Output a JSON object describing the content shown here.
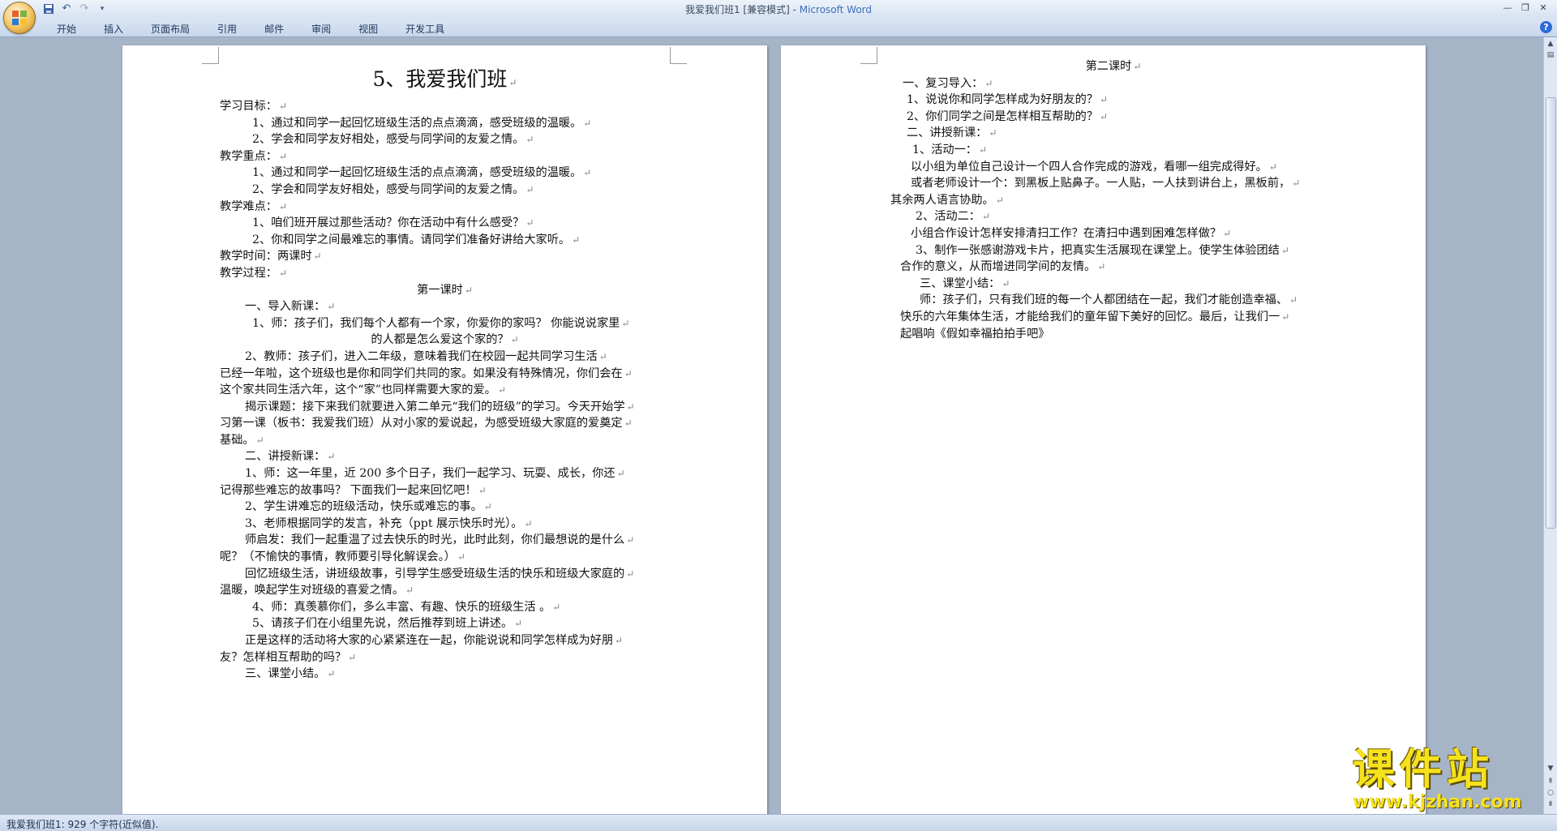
{
  "window": {
    "title_doc": "我爱我们班1 [兼容模式] - ",
    "title_app": "Microsoft Word"
  },
  "quick_access": [
    "save-icon",
    "undo-icon",
    "redo-icon",
    "customize-icon"
  ],
  "ribbon": {
    "tabs": [
      "开始",
      "插入",
      "页面布局",
      "引用",
      "邮件",
      "审阅",
      "视图",
      "开发工具"
    ]
  },
  "page1": {
    "title": "5、我爱我们班",
    "lines": [
      {
        "t": "学习目标：",
        "s": ""
      },
      {
        "t": "1、通过和同学一起回忆班级生活的点点滴滴，感受班级的温暖。",
        "s": "ind2"
      },
      {
        "t": "2、学会和同学友好相处，感受与同学间的友爱之情。",
        "s": "ind2"
      },
      {
        "t": "教学重点：",
        "s": ""
      },
      {
        "t": "1、通过和同学一起回忆班级生活的点点滴滴，感受班级的温暖。",
        "s": "ind2"
      },
      {
        "t": "2、学会和同学友好相处，感受与同学间的友爱之情。",
        "s": "ind2"
      },
      {
        "t": "教学难点：",
        "s": ""
      },
      {
        "t": "1、咱们班开展过那些活动？你在活动中有什么感受？",
        "s": "ind2"
      },
      {
        "t": "2、你和同学之间最难忘的事情。请同学们准备好讲给大家听。",
        "s": "ind2"
      },
      {
        "t": "教学时间：两课时",
        "s": ""
      },
      {
        "t": "教学过程：",
        "s": ""
      },
      {
        "t": "第一课时",
        "s": "center"
      },
      {
        "t": "一、导入新课：",
        "s": "ind1"
      },
      {
        "t": "1、师：孩子们，我们每个人都有一个家，你爱你的家吗？  你能说说家里",
        "s": "ind2"
      },
      {
        "t": "的人都是怎么爱这个家的？",
        "s": "center"
      },
      {
        "t": "2、教师：孩子们，进入二年级，意味着我们在校园一起共同学习生活",
        "s": "ind1"
      },
      {
        "t": "已经一年啦，这个班级也是你和同学们共同的家。如果没有特殊情况，你们会在",
        "s": ""
      },
      {
        "t": "这个家共同生活六年，这个“家”也同样需要大家的爱。",
        "s": ""
      },
      {
        "t": "揭示课题：接下来我们就要进入第二单元“我们的班级”的学习。今天开始学",
        "s": "ind1"
      },
      {
        "t": "习第一课（板书：我爱我们班）从对小家的爱说起，为感受班级大家庭的爱奠定",
        "s": ""
      },
      {
        "t": "基础。",
        "s": ""
      },
      {
        "t": "二、讲授新课：",
        "s": "ind1"
      },
      {
        "t": "1、师：这一年里，近 200 多个日子，我们一起学习、玩耍、成长，你还",
        "s": "ind1"
      },
      {
        "t": "记得那些难忘的故事吗？  下面我们一起来回忆吧！",
        "s": ""
      },
      {
        "t": "2、学生讲难忘的班级活动，快乐或难忘的事。",
        "s": "ind1"
      },
      {
        "t": "3、老师根据同学的发言，补充（ppt 展示快乐时光）。",
        "s": "ind1"
      },
      {
        "t": "师启发：我们一起重温了过去快乐的时光，此时此刻，你们最想说的是什么",
        "s": "ind1"
      },
      {
        "t": "呢？（不愉快的事情，教师要引导化解误会。）",
        "s": ""
      },
      {
        "t": "回忆班级生活，讲班级故事，引导学生感受班级生活的快乐和班级大家庭的",
        "s": "ind1"
      },
      {
        "t": "温暖，唤起学生对班级的喜爱之情。",
        "s": ""
      },
      {
        "t": "4、师：真羡慕你们，多么丰富、有趣、快乐的班级生活  。",
        "s": "ind2"
      },
      {
        "t": "5、请孩子们在小组里先说，然后推荐到班上讲述。",
        "s": "ind2"
      },
      {
        "t": "正是这样的活动将大家的心紧紧连在一起，你能说说和同学怎样成为好朋",
        "s": "ind1"
      },
      {
        "t": "友？怎样相互帮助的吗？",
        "s": ""
      },
      {
        "t": "三、课堂小结。",
        "s": "ind1"
      }
    ]
  },
  "page2": {
    "lines": [
      {
        "t": "第二课时",
        "s": "center"
      },
      {
        "t": "一、复习导入：",
        "s": "ind1"
      },
      {
        "t": "1、说说你和同学怎样成为好朋友的？",
        "s": "ind1x"
      },
      {
        "t": "2、你们同学之间是怎样相互帮助的？",
        "s": "ind1x"
      },
      {
        "t": "二、讲授新课：",
        "s": "ind1x"
      },
      {
        "t": "1、活动一：",
        "s": "ind2x"
      },
      {
        "t": "以小组为单位自己设计一个四人合作完成的游戏，看哪一组完成得好。",
        "s": "ind1y"
      },
      {
        "t": "或者老师设计一个：到黑板上贴鼻子。一人贴，一人扶到讲台上，黑板前，",
        "s": "ind1y"
      },
      {
        "t": "其余两人语言协助。",
        "s": "neg"
      },
      {
        "t": "2、活动二：",
        "s": "ind2y"
      },
      {
        "t": "小组合作设计怎样安排清扫工作？在清扫中遇到困难怎样做？",
        "s": "ind1y"
      },
      {
        "t": "3、制作一张感谢游戏卡片，把真实生活展现在课堂上。使学生体验团结",
        "s": "ind2y"
      },
      {
        "t": "合作的意义，从而增进同学间的友情。",
        "s": "base"
      },
      {
        "t": "三、课堂小结：",
        "s": "ind3y"
      },
      {
        "t": "师：孩子们，只有我们班的每一个人都团结在一起，我们才能创造幸福、",
        "s": "ind4y"
      },
      {
        "t": "快乐的六年集体生活，才能给我们的童年留下美好的回忆。最后，让我们一",
        "s": "base"
      },
      {
        "t": "起唱响《假如幸福拍拍手吧》",
        "s": "base"
      }
    ]
  },
  "statusbar": {
    "text": "我爱我们班1: 929 个字符(近似值)."
  },
  "watermark": {
    "big": "课件站",
    "small": "www.kjzhan.com"
  }
}
